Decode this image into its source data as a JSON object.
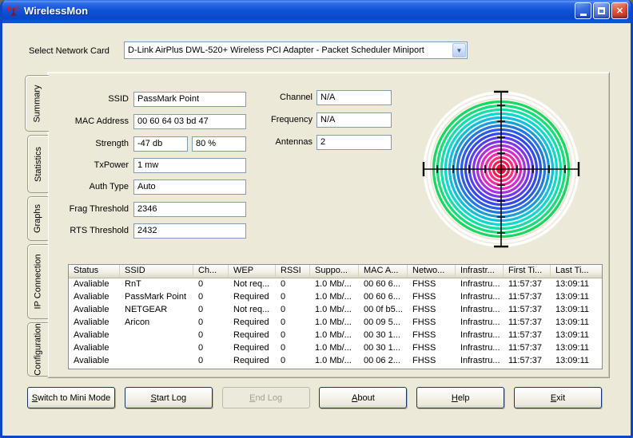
{
  "window": {
    "title": "WirelessMon"
  },
  "titlebar_buttons": {
    "minimize": "minimize",
    "maximize": "maximize",
    "close": "close"
  },
  "network_card": {
    "label": "Select Network Card",
    "selected": "D-Link AirPlus DWL-520+ Wireless PCI Adapter - Packet Scheduler Miniport"
  },
  "tabs": [
    {
      "label": "Summary",
      "active": true
    },
    {
      "label": "Statistics",
      "active": false
    },
    {
      "label": "Graphs",
      "active": false
    },
    {
      "label": "IP Connection",
      "active": false
    },
    {
      "label": "Configuration",
      "active": false
    }
  ],
  "summary": {
    "fields_left": [
      {
        "label": "SSID",
        "value": "PassMark Point"
      },
      {
        "label": "MAC Address",
        "value": "00 60 64 03 bd 47"
      },
      {
        "label": "Strength",
        "value": "-47 db",
        "value2": "80 %"
      },
      {
        "label": "TxPower",
        "value": "1 mw"
      },
      {
        "label": "Auth Type",
        "value": "Auto"
      },
      {
        "label": "Frag Threshold",
        "value": "2346"
      },
      {
        "label": "RTS Threshold",
        "value": "2432"
      }
    ],
    "fields_right": [
      {
        "label": "Channel",
        "value": "N/A"
      },
      {
        "label": "Frequency",
        "value": "N/A"
      },
      {
        "label": "Antennas",
        "value": "2"
      }
    ],
    "signal_plot": {
      "ring_colors_center_to_edge": [
        "#f5103c",
        "#fb1a4e",
        "#ff2e7c",
        "#f52ba6",
        "#dc2bc8",
        "#ad2fe2",
        "#7d34f0",
        "#5340f2",
        "#3349ee",
        "#2b5ce8",
        "#2277e0",
        "#189ddb",
        "#10bfdb",
        "#0cd8cc",
        "#0ee0a8",
        "#12df78",
        "#16d85c"
      ],
      "outer_ring_color": "#ffffff",
      "crosshair_color": "#0a0a0a"
    }
  },
  "access_points_table": {
    "headers": [
      "Status",
      "SSID",
      "Ch...",
      "WEP",
      "RSSI",
      "Suppo...",
      "MAC A...",
      "Netwo...",
      "Infrastr...",
      "First Ti...",
      "Last Ti..."
    ],
    "rows": [
      [
        "Avaliable",
        "RnT",
        "0",
        "Not req...",
        "0",
        "1.0 Mb/...",
        "00 60 6...",
        "FHSS",
        "Infrastru...",
        "11:57:37",
        "13:09:11"
      ],
      [
        "Avaliable",
        "PassMark Point",
        "0",
        "Required",
        "0",
        "1.0 Mb/...",
        "00 60 6...",
        "FHSS",
        "Infrastru...",
        "11:57:37",
        "13:09:11"
      ],
      [
        "Avaliable",
        "NETGEAR",
        "0",
        "Not req...",
        "0",
        "1.0 Mb/...",
        "00 0f b5...",
        "FHSS",
        "Infrastru...",
        "11:57:37",
        "13:09:11"
      ],
      [
        "Avaliable",
        "Aricon",
        "0",
        "Required",
        "0",
        "1.0 Mb/...",
        "00 09 5...",
        "FHSS",
        "Infrastru...",
        "11:57:37",
        "13:09:11"
      ],
      [
        "Avaliable",
        "",
        "0",
        "Required",
        "0",
        "1.0 Mb/...",
        "00 30 1...",
        "FHSS",
        "Infrastru...",
        "11:57:37",
        "13:09:11"
      ],
      [
        "Avaliable",
        "",
        "0",
        "Required",
        "0",
        "1.0 Mb/...",
        "00 30 1...",
        "FHSS",
        "Infrastru...",
        "11:57:37",
        "13:09:11"
      ],
      [
        "Avaliable",
        "",
        "0",
        "Required",
        "0",
        "1.0 Mb/...",
        "00 06 2...",
        "FHSS",
        "Infrastru...",
        "11:57:37",
        "13:09:11"
      ]
    ]
  },
  "footer_buttons": [
    {
      "label": "Switch to Mini Mode",
      "accel_index": 0,
      "enabled": true
    },
    {
      "label": "Start Log",
      "accel_index": 0,
      "enabled": true
    },
    {
      "label": "End Log",
      "accel_index": 0,
      "enabled": false
    },
    {
      "label": "About",
      "accel_index": 0,
      "enabled": true
    },
    {
      "label": "Help",
      "accel_index": 0,
      "enabled": true
    },
    {
      "label": "Exit",
      "accel_index": 0,
      "enabled": true
    }
  ],
  "colors": {
    "titlebar_blue": "#0f52d8",
    "dialog_bg": "#ECE9D8",
    "field_border": "#7F9DB9",
    "close_red": "#d6492b"
  }
}
